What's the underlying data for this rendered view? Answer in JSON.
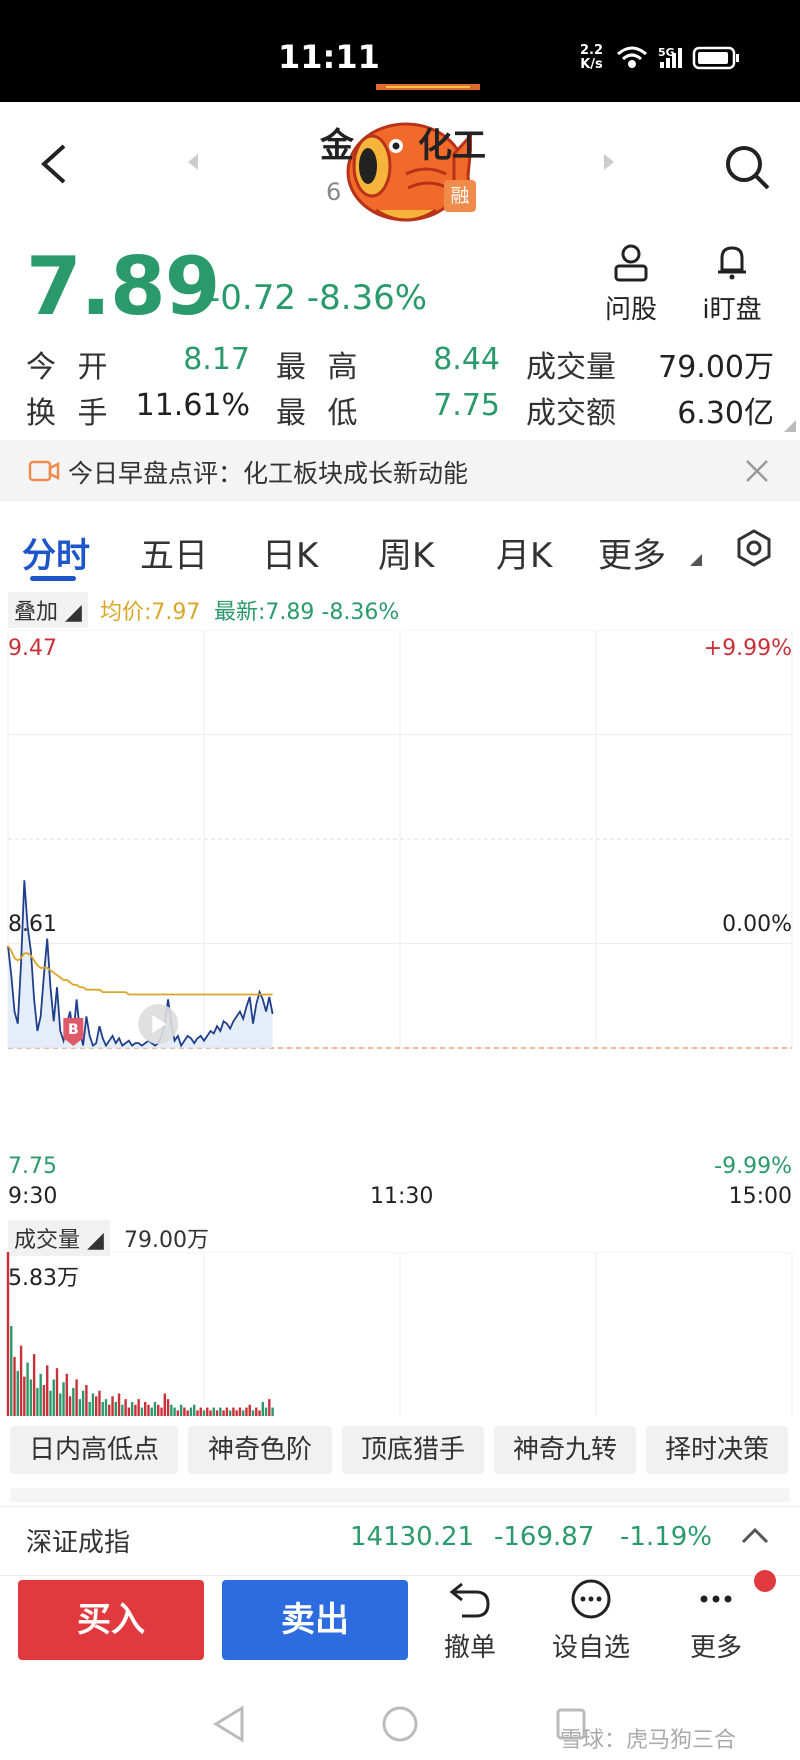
{
  "status_bar": {
    "time": "11:11",
    "net_speed_line1": "2.2",
    "net_speed_line2": "K/s",
    "network_badge": "5G",
    "icons": [
      "wifi-icon",
      "signal-icon",
      "battery-icon"
    ]
  },
  "header": {
    "title_partial": "金",
    "title_suffix": "化工",
    "code_partial": "6",
    "margin_badge": "融"
  },
  "quote": {
    "price": "7.89",
    "change": "-0.72",
    "change_pct": "-8.36%",
    "ask_label": "问股",
    "watch_label": "i盯盘"
  },
  "stats": {
    "open_label": "今 开",
    "open": "8.17",
    "high_label": "最 高",
    "high": "8.44",
    "volume_label": "成交量",
    "volume": "79.00万",
    "turnover_label": "换 手",
    "turnover": "11.61%",
    "low_label": "最 低",
    "low": "7.75",
    "amount_label": "成交额",
    "amount": "6.30亿"
  },
  "news": {
    "text": "今日早盘点评：化工板块成长新动能"
  },
  "tabs": [
    "分时",
    "五日",
    "日K",
    "周K",
    "月K",
    "更多"
  ],
  "legend": {
    "overlay_label": "叠加",
    "avg_label": "均价:7.97",
    "latest_label": "最新:7.89",
    "latest_pct": "-8.36%"
  },
  "chart_data": {
    "type": "line",
    "price_axis": {
      "top": "9.47",
      "mid": "8.61",
      "bottom": "7.75"
    },
    "pct_axis": {
      "top": "+9.99%",
      "mid": "0.00%",
      "bottom": "-9.99%"
    },
    "ylim": [
      7.75,
      9.47
    ],
    "time_labels": [
      "9:30",
      "11:30",
      "15:00"
    ],
    "minutes_total": 240,
    "price_series": [
      8.17,
      8.05,
      7.9,
      7.85,
      8.1,
      8.44,
      8.25,
      8.15,
      7.95,
      7.82,
      7.88,
      8.05,
      8.2,
      8.0,
      7.86,
      8.0,
      7.82,
      7.78,
      7.85,
      7.9,
      7.8,
      7.95,
      7.82,
      7.76,
      7.88,
      7.8,
      7.76,
      7.77,
      7.84,
      7.79,
      7.76,
      7.78,
      7.8,
      7.77,
      7.79,
      7.76,
      7.77,
      7.78,
      7.76,
      7.77,
      7.77,
      7.76,
      7.77,
      7.78,
      7.77,
      7.76,
      7.77,
      7.8,
      7.85,
      7.95,
      7.85,
      7.78,
      7.8,
      7.76,
      7.78,
      7.8,
      7.79,
      7.77,
      7.79,
      7.8,
      7.78,
      7.8,
      7.82,
      7.81,
      7.84,
      7.82,
      7.86,
      7.85,
      7.83,
      7.86,
      7.88,
      7.9,
      7.87,
      7.92,
      7.96,
      7.85,
      7.93,
      7.98,
      7.95,
      7.9,
      7.96,
      7.89
    ],
    "avg_series": [
      8.17,
      8.15,
      8.12,
      8.11,
      8.12,
      8.14,
      8.14,
      8.13,
      8.11,
      8.09,
      8.08,
      8.08,
      8.08,
      8.07,
      8.06,
      8.05,
      8.04,
      8.03,
      8.03,
      8.02,
      8.01,
      8.01,
      8.0,
      8.0,
      7.99,
      7.99,
      7.99,
      7.99,
      7.99,
      7.98,
      7.98,
      7.98,
      7.98,
      7.98,
      7.98,
      7.98,
      7.98,
      7.97,
      7.97,
      7.97,
      7.97,
      7.97,
      7.97,
      7.97,
      7.97,
      7.97,
      7.97,
      7.97,
      7.97,
      7.97,
      7.97,
      7.97,
      7.97,
      7.97,
      7.97,
      7.97,
      7.97,
      7.97,
      7.97,
      7.97,
      7.97,
      7.97,
      7.97,
      7.97,
      7.97,
      7.97,
      7.97,
      7.97,
      7.97,
      7.97,
      7.97,
      7.97,
      7.97,
      7.97,
      7.97,
      7.97,
      7.97,
      7.97,
      7.97,
      7.97,
      7.97,
      7.97
    ],
    "volume_label": "成交量",
    "volume_total": "79.00万",
    "volume_max_label": "5.83万",
    "volume_series": [
      5.83,
      3.2,
      2.1,
      1.6,
      2.5,
      1.4,
      1.9,
      1.3,
      2.2,
      1.0,
      1.5,
      1.1,
      1.8,
      0.9,
      1.3,
      1.7,
      0.8,
      1.2,
      1.5,
      0.7,
      1.0,
      1.3,
      0.6,
      0.9,
      1.1,
      0.5,
      0.8,
      0.7,
      0.9,
      0.5,
      0.6,
      0.4,
      0.7,
      0.5,
      0.8,
      0.4,
      0.6,
      0.3,
      0.5,
      0.4,
      0.6,
      0.3,
      0.5,
      0.4,
      0.3,
      0.5,
      0.4,
      0.3,
      0.8,
      0.6,
      0.4,
      0.3,
      0.2,
      0.4,
      0.3,
      0.2,
      0.3,
      0.4,
      0.2,
      0.3,
      0.2,
      0.3,
      0.2,
      0.3,
      0.2,
      0.3,
      0.2,
      0.3,
      0.2,
      0.3,
      0.2,
      0.3,
      0.2,
      0.3,
      0.4,
      0.2,
      0.3,
      0.2,
      0.5,
      0.3,
      0.6,
      0.3
    ],
    "volume_colors": [
      "up",
      "down",
      "up",
      "down",
      "up",
      "up",
      "down",
      "down",
      "up",
      "down",
      "down",
      "up",
      "up",
      "down",
      "down",
      "up",
      "down",
      "down",
      "up",
      "up",
      "down",
      "up",
      "down",
      "down",
      "up",
      "down",
      "down",
      "up",
      "up",
      "down",
      "down",
      "up",
      "up",
      "down",
      "up",
      "down",
      "up",
      "up",
      "down",
      "up",
      "up",
      "down",
      "up",
      "up",
      "down",
      "down",
      "up",
      "up",
      "up",
      "up",
      "down",
      "down",
      "up",
      "down",
      "up",
      "up",
      "down",
      "down",
      "up",
      "up",
      "down",
      "up",
      "up",
      "down",
      "up",
      "down",
      "up",
      "up",
      "down",
      "up",
      "up",
      "up",
      "down",
      "up",
      "up",
      "down",
      "up",
      "up",
      "down",
      "down",
      "up",
      "down"
    ]
  },
  "tools": [
    "日内高低点",
    "神奇色阶",
    "顶底猎手",
    "神奇九转",
    "择时决策"
  ],
  "index": {
    "name": "深证成指",
    "value": "14130.21",
    "change": "-169.87",
    "change_pct": "-1.19%"
  },
  "actions": {
    "buy": "买入",
    "sell": "卖出",
    "cancel": "撤单",
    "watchlist": "设自选",
    "more": "更多"
  },
  "watermark": "雪球：虎马狗三合",
  "colors": {
    "up": "#c8313a",
    "down": "#2a9a6c",
    "accent": "#1e56c9",
    "avg_line": "#d9a62a"
  }
}
